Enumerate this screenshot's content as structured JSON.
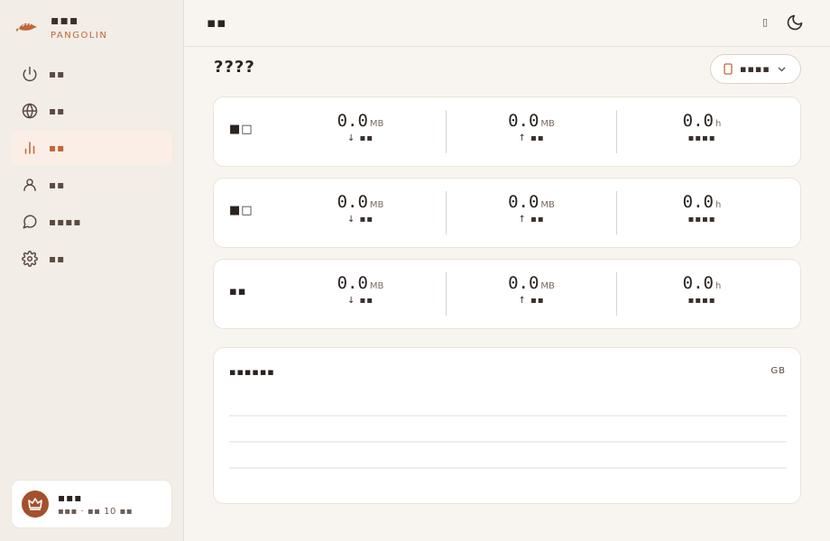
{
  "brand": {
    "name": "▪▪▪",
    "subtitle": "PANGOLIN"
  },
  "sidebar": {
    "items": [
      {
        "label": "▪▪",
        "icon": "power-icon"
      },
      {
        "label": "▪▪",
        "icon": "globe-icon"
      },
      {
        "label": "▪▪",
        "icon": "bar-chart-icon",
        "active": true
      },
      {
        "label": "▪▪",
        "icon": "user-icon"
      },
      {
        "label": "▪▪▪▪",
        "icon": "message-icon"
      },
      {
        "label": "▪▪",
        "icon": "gear-icon"
      }
    ]
  },
  "user": {
    "name": "▪▪▪",
    "meta": "▪▪▪ · ▪▪ 10 ▪▪"
  },
  "header": {
    "title": "▪▪",
    "lang_label": "▯"
  },
  "page": {
    "title": "????",
    "device_select": "▪▪▪▪"
  },
  "stats": [
    {
      "label": "■□",
      "download": "0.0",
      "download_unit": "MB",
      "download_label": "↓ ▪▪",
      "upload": "0.0",
      "upload_unit": "MB",
      "upload_label": "↑ ▪▪",
      "duration": "0.0",
      "duration_unit": "h",
      "duration_label": "▪▪▪▪"
    },
    {
      "label": "■□",
      "download": "0.0",
      "download_unit": "MB",
      "download_label": "↓ ▪▪",
      "upload": "0.0",
      "upload_unit": "MB",
      "upload_label": "↑ ▪▪",
      "duration": "0.0",
      "duration_unit": "h",
      "duration_label": "▪▪▪▪"
    },
    {
      "label": "▪▪",
      "download": "0.0",
      "download_unit": "MB",
      "download_label": "↓ ▪▪",
      "upload": "0.0",
      "upload_unit": "MB",
      "upload_label": "↑ ▪▪",
      "duration": "0.0",
      "duration_unit": "h",
      "duration_label": "▪▪▪▪"
    }
  ],
  "chart": {
    "title": "▪▪▪▪▪▪",
    "unit": "GB"
  },
  "colors": {
    "accent": "#c0663a",
    "avatar": "#a4502c",
    "active_bg": "#fbeee6"
  }
}
